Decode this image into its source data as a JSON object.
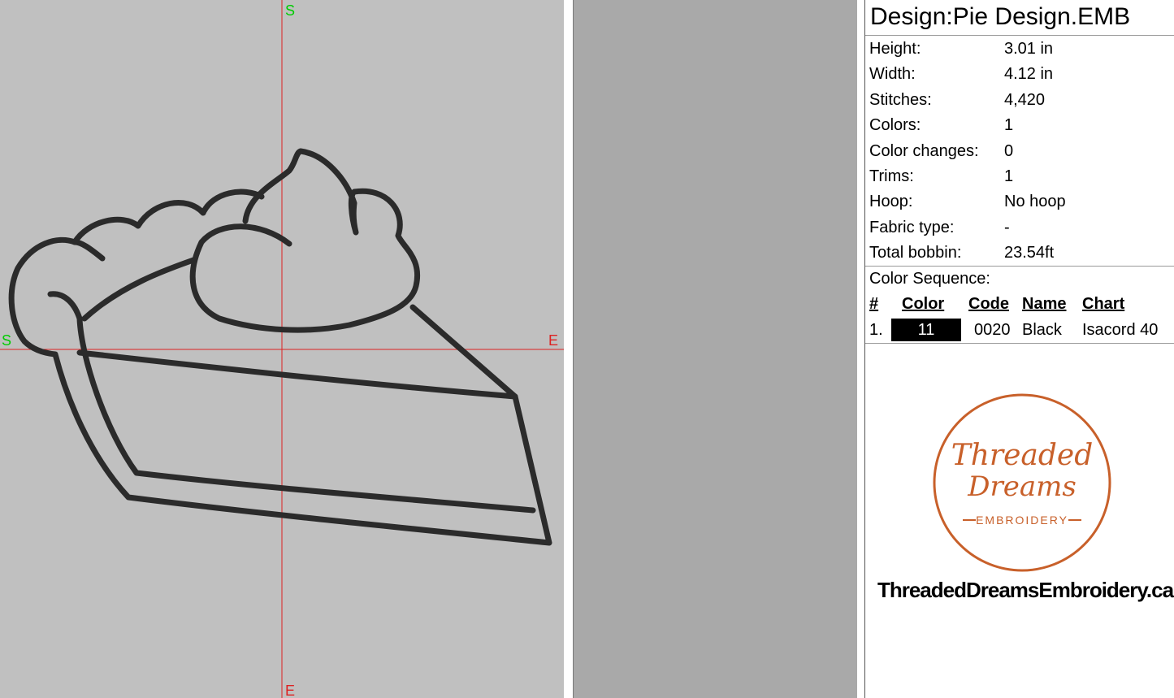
{
  "canvas": {
    "background_color": "#c0c0c0",
    "axis_color": "#dd2222",
    "start_marker_color": "#00cc00",
    "end_marker_color": "#dd2222",
    "axis_markers": {
      "top": "S",
      "left": "S",
      "right": "E",
      "bottom": "E"
    },
    "stitch_color": "#2b2b2b"
  },
  "design": {
    "title": "Design:Pie Design.EMB",
    "properties": [
      {
        "label": "Height:",
        "value": "3.01 in"
      },
      {
        "label": "Width:",
        "value": "4.12 in"
      },
      {
        "label": "Stitches:",
        "value": "4,420"
      },
      {
        "label": "Colors:",
        "value": "1"
      },
      {
        "label": "Color changes:",
        "value": "0"
      },
      {
        "label": "Trims:",
        "value": "1"
      },
      {
        "label": "Hoop:",
        "value": "No hoop"
      },
      {
        "label": "Fabric type:",
        "value": "-"
      },
      {
        "label": "Total bobbin:",
        "value": "23.54ft"
      }
    ]
  },
  "color_sequence": {
    "title": "Color Sequence:",
    "headers": {
      "num": "#",
      "color": "Color",
      "code": "Code",
      "name": "Name",
      "chart": "Chart"
    },
    "rows": [
      {
        "num": "1.",
        "color_label": "11",
        "swatch": "#000000",
        "code": "0020",
        "name": "Black",
        "chart": "Isacord 40"
      }
    ]
  },
  "logo": {
    "line1": "Threaded",
    "line2": "Dreams",
    "line3": "EMBROIDERY",
    "color": "#c8602a"
  },
  "site_url": "ThreadedDreamsEmbroidery.ca"
}
